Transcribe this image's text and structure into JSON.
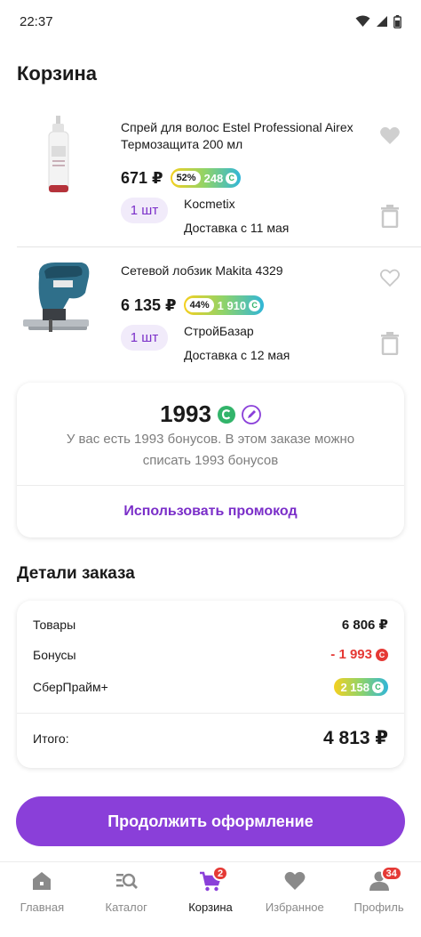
{
  "status_bar": {
    "time": "22:37"
  },
  "page_title": "Корзина",
  "items": [
    {
      "name": "Спрей для волос Estel Professional Airex Термозащита 200 мл",
      "price": "671 ₽",
      "bonus_percent": "52%",
      "bonus_value": "248",
      "quantity": "1 шт",
      "seller": "Kocmetix",
      "delivery": "Доставка с 11 мая"
    },
    {
      "name": "Сетевой лобзик Makita 4329",
      "price": "6 135 ₽",
      "bonus_percent": "44%",
      "bonus_value": "1 910",
      "quantity": "1 шт",
      "seller": "СтройБазар",
      "delivery": "Доставка с 12 мая"
    }
  ],
  "bonus_card": {
    "amount": "1993",
    "text": "У вас есть 1993 бонусов. В этом заказе можно списать 1993 бонусов",
    "promo_label": "Использовать промокод"
  },
  "order_details": {
    "title": "Детали заказа",
    "goods_label": "Товары",
    "goods_value": "6 806 ₽",
    "bonuses_label": "Бонусы",
    "bonuses_value": "- 1 993",
    "prime_label": "СберПрайм+",
    "prime_value": "2 158",
    "total_label": "Итого:",
    "total_value": "4 813 ₽"
  },
  "continue_label": "Продолжить оформление",
  "nav": {
    "home": "Главная",
    "catalog": "Каталог",
    "cart": "Корзина",
    "cart_badge": "2",
    "favorites": "Избранное",
    "profile": "Профиль",
    "profile_badge": "34"
  },
  "colors": {
    "accent": "#8a3fd9",
    "accent_text": "#7b2fc9",
    "negative": "#e53935",
    "bonus_green": "#32b46a"
  }
}
